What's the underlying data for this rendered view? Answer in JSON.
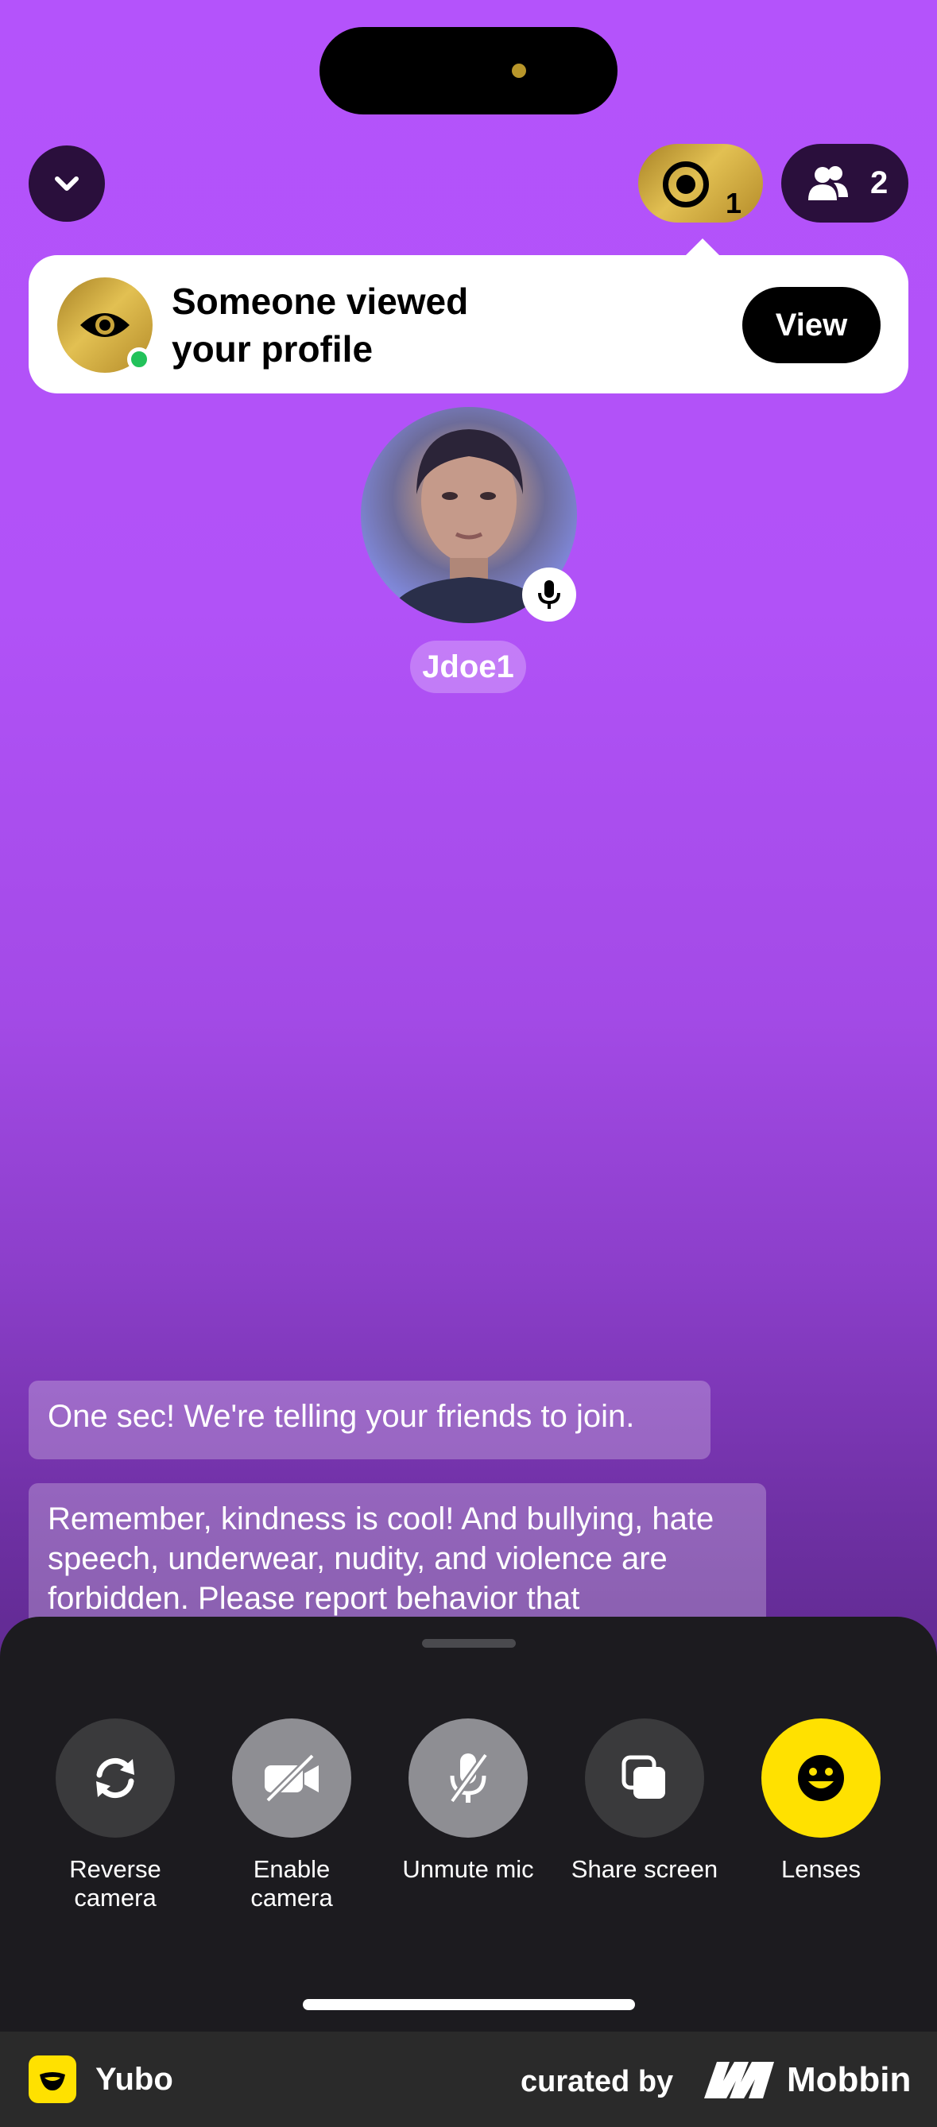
{
  "header": {
    "collapse_icon": "chevron-down-icon",
    "viewers": {
      "icon": "target-icon",
      "count": "1"
    },
    "friends": {
      "icon": "people-icon",
      "count": "2"
    }
  },
  "toast": {
    "icon": "eye-icon",
    "title": "Someone viewed your profile",
    "button": "View"
  },
  "host": {
    "username": "Jdoe1",
    "mic_icon": "mic-icon"
  },
  "messages": [
    "One sec! We're telling your friends to join.",
    "Remember, kindness is cool! And bullying, hate speech, underwear, nudity, and violence are forbidden. Please report behavior that"
  ],
  "controls": [
    {
      "label_line1": "Reverse",
      "label_line2": "camera",
      "icon": "rotate-camera-icon"
    },
    {
      "label_line1": "Enable",
      "label_line2": "camera",
      "icon": "camera-off-icon"
    },
    {
      "label_line1": "Unmute mic",
      "label_line2": "",
      "icon": "mic-off-icon"
    },
    {
      "label_line1": "Share screen",
      "label_line2": "",
      "icon": "share-screen-icon"
    },
    {
      "label_line1": "Lenses",
      "label_line2": "",
      "icon": "smiley-icon"
    }
  ],
  "footer": {
    "app_name": "Yubo",
    "curated_by": "curated by",
    "brand": "Mobbin"
  },
  "colors": {
    "background_top": "#b453fb",
    "gold": "#d4b040",
    "lenses_yellow": "#ffe100",
    "sheet": "#1c1b1f"
  }
}
